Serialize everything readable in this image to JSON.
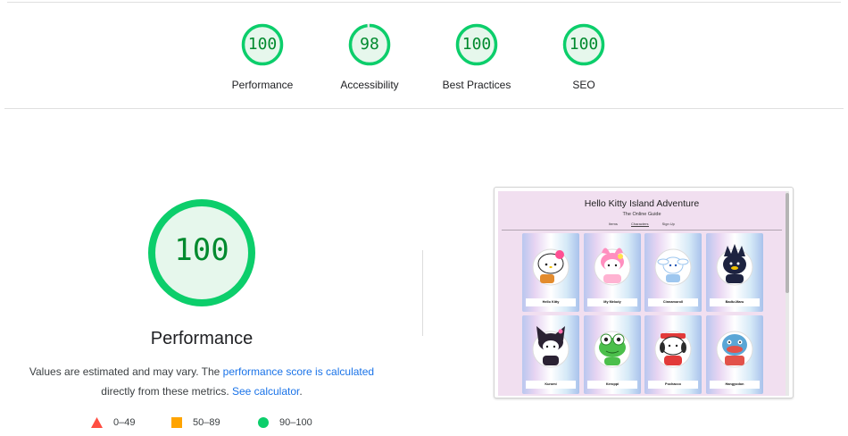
{
  "categories": [
    {
      "score": "100",
      "label": "Performance"
    },
    {
      "score": "98",
      "label": "Accessibility"
    },
    {
      "score": "100",
      "label": "Best Practices"
    },
    {
      "score": "100",
      "label": "SEO"
    }
  ],
  "main": {
    "score": "100",
    "title": "Performance",
    "desc_pre": "Values are estimated and may vary. The ",
    "desc_link1": "performance score is calculated",
    "desc_mid": "directly from these metrics. ",
    "desc_link2": "See calculator",
    "desc_post": "."
  },
  "legend": {
    "fail": "0–49",
    "average": "50–89",
    "pass": "90–100"
  },
  "colors": {
    "pass": "#0cce6b",
    "pass_text": "#008a2e",
    "pass_fill": "#e6f7ec",
    "average": "#ffa400",
    "fail": "#ff4e42",
    "link": "#1a73e8"
  },
  "screenshot": {
    "site_title": "Hello Kitty Island Adventure",
    "site_subtitle": "The Online Guide",
    "nav": [
      "Items",
      "Characters",
      "Sign Up"
    ],
    "nav_active": "Characters",
    "characters": [
      "Hello Kitty",
      "My Melody",
      "Cinnamoroll",
      "Badtz-Maru",
      "Kuromi",
      "Keroppi",
      "Pochacco",
      "Hangyodon"
    ]
  }
}
